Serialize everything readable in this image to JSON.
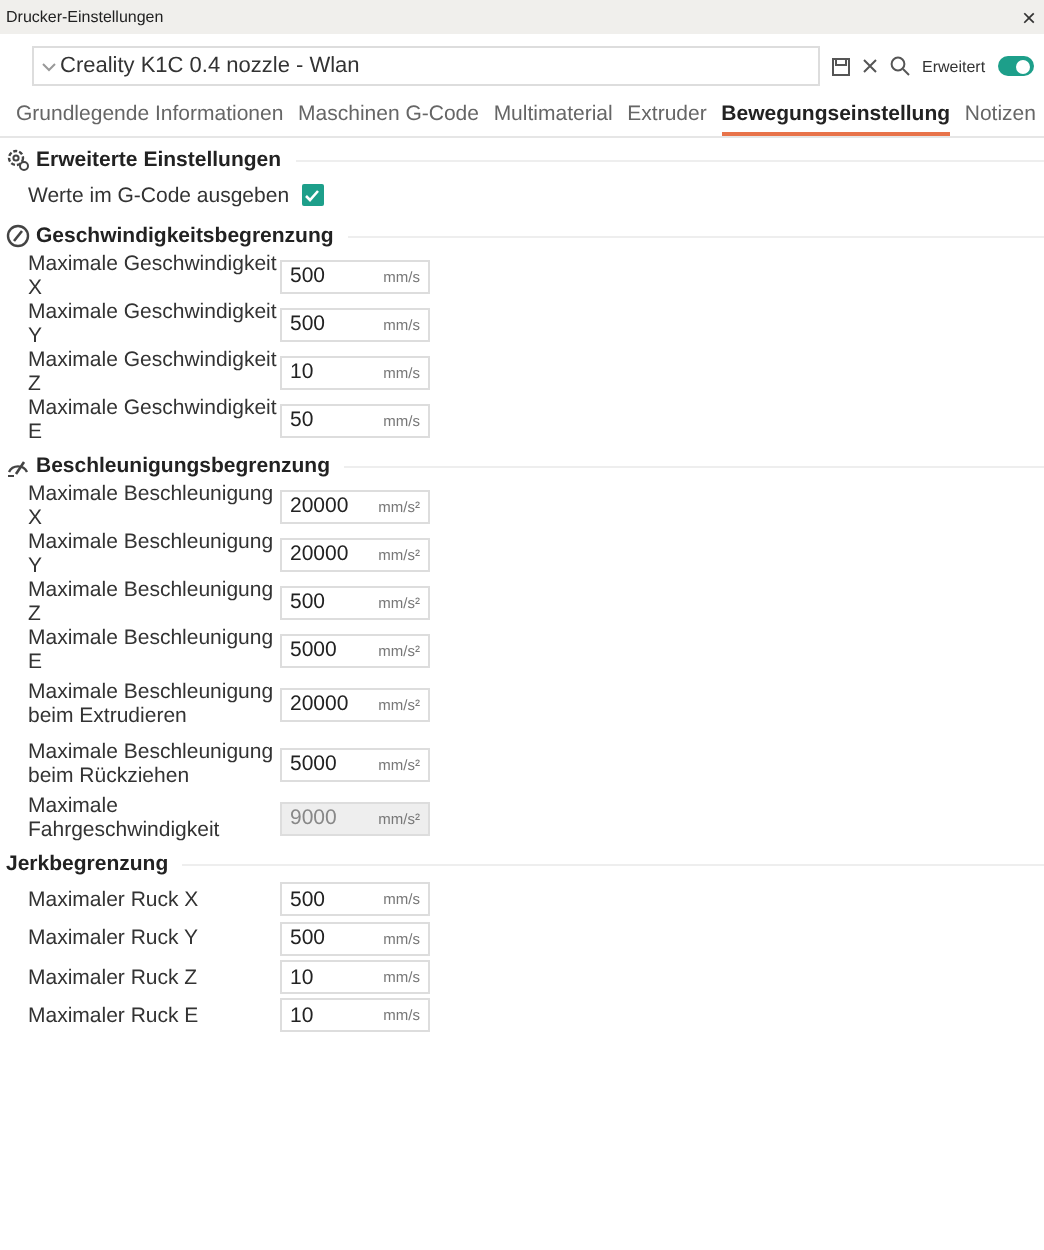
{
  "window": {
    "title": "Drucker-Einstellungen",
    "close": "×"
  },
  "preset": {
    "value": "Creality K1C 0.4 nozzle - Wlan",
    "advanced_label": "Erweitert",
    "advanced_on": true
  },
  "tabs": [
    {
      "label": "Grundlegende Informationen",
      "selected": false
    },
    {
      "label": "Maschinen G-Code",
      "selected": false
    },
    {
      "label": "Multimaterial",
      "selected": false
    },
    {
      "label": "Extruder",
      "selected": false
    },
    {
      "label": "Bewegungseinstellung",
      "selected": true
    },
    {
      "label": "Notizen",
      "selected": false
    }
  ],
  "sections": [
    {
      "title": "Erweiterte Einstellungen",
      "rows": [
        {
          "kind": "checkbox",
          "label": "Werte im G-Code ausgeben",
          "checked": true
        }
      ]
    },
    {
      "title": "Geschwindigkeitsbegrenzung",
      "rows": [
        {
          "kind": "field",
          "label": "Maximale Geschwindigkeit X",
          "value": "500",
          "unit": "mm/s",
          "disabled": false
        },
        {
          "kind": "field",
          "label": "Maximale Geschwindigkeit Y",
          "value": "500",
          "unit": "mm/s",
          "disabled": false
        },
        {
          "kind": "field",
          "label": "Maximale Geschwindigkeit Z",
          "value": "10",
          "unit": "mm/s",
          "disabled": false
        },
        {
          "kind": "field",
          "label": "Maximale Geschwindigkeit E",
          "value": "50",
          "unit": "mm/s",
          "disabled": false
        }
      ]
    },
    {
      "title": "Beschleunigungsbegrenzung",
      "rows": [
        {
          "kind": "field",
          "label": "Maximale Beschleunigung X",
          "value": "20000",
          "unit": "mm/s²",
          "disabled": false
        },
        {
          "kind": "field",
          "label": "Maximale Beschleunigung Y",
          "value": "20000",
          "unit": "mm/s²",
          "disabled": false
        },
        {
          "kind": "field",
          "label": "Maximale Beschleunigung Z",
          "value": "500",
          "unit": "mm/s²",
          "disabled": false
        },
        {
          "kind": "field",
          "label": "Maximale Beschleunigung E",
          "value": "5000",
          "unit": "mm/s²",
          "disabled": false
        },
        {
          "kind": "field",
          "label": "Maximale Beschleunigung beim Extrudieren",
          "value": "20000",
          "unit": "mm/s²",
          "disabled": false
        },
        {
          "kind": "field",
          "label": "Maximale Beschleunigung beim Rückziehen",
          "value": "5000",
          "unit": "mm/s²",
          "disabled": false
        },
        {
          "kind": "field",
          "label": "Maximale Fahrgeschwindigkeit",
          "value": "9000",
          "unit": "mm/s²",
          "disabled": true
        }
      ]
    },
    {
      "title": "Jerkbegrenzung",
      "rows": [
        {
          "kind": "field",
          "label": "Maximaler Ruck X",
          "value": "500",
          "unit": "mm/s",
          "disabled": false
        },
        {
          "kind": "field",
          "label": "Maximaler Ruck Y",
          "value": "500",
          "unit": "mm/s",
          "disabled": false
        },
        {
          "kind": "field",
          "label": "Maximaler Ruck Z",
          "value": "10",
          "unit": "mm/s",
          "disabled": false
        },
        {
          "kind": "field",
          "label": "Maximaler Ruck E",
          "value": "10",
          "unit": "mm/s",
          "disabled": false
        }
      ]
    }
  ]
}
